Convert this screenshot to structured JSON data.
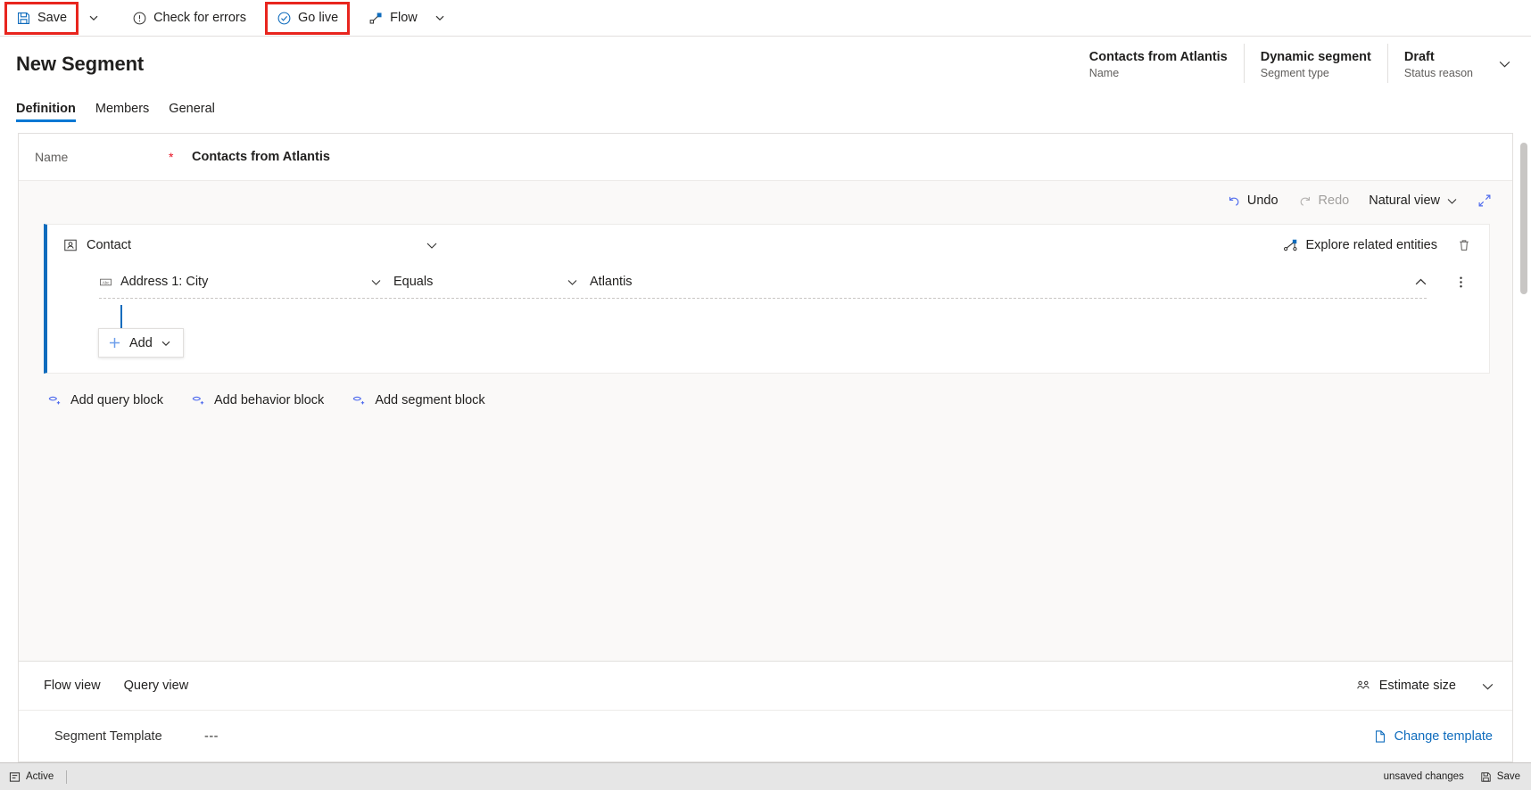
{
  "commandbar": {
    "save_label": "Save",
    "save_caret_icon": "chevron-down-icon",
    "check_errors_label": "Check for errors",
    "go_live_label": "Go live",
    "flow_label": "Flow",
    "flow_caret_icon": "chevron-down-icon",
    "highlight_color": "#e8251e"
  },
  "header": {
    "title": "New Segment",
    "meta": [
      {
        "value": "Contacts from Atlantis",
        "label": "Name"
      },
      {
        "value": "Dynamic segment",
        "label": "Segment type"
      },
      {
        "value": "Draft",
        "label": "Status reason"
      }
    ],
    "expand_icon": "chevron-down-icon"
  },
  "tabs": [
    {
      "label": "Definition",
      "active": true
    },
    {
      "label": "Members",
      "active": false
    },
    {
      "label": "General",
      "active": false
    }
  ],
  "name_field": {
    "label": "Name",
    "required_marker": "*",
    "value": "Contacts from Atlantis"
  },
  "editor_toolbar": {
    "undo_label": "Undo",
    "redo_label": "Redo",
    "view_label": "Natural view",
    "view_caret_icon": "chevron-down-icon",
    "expand_icon": "expand-diagonal-icon"
  },
  "query_block": {
    "entity_icon": "contact-entity-icon",
    "entity_label": "Contact",
    "collapse_icon": "chevron-down-icon",
    "explore_label": "Explore related entities",
    "explore_icon": "related-entities-icon",
    "delete_icon": "trash-icon",
    "condition": {
      "field_icon": "text-field-icon",
      "field": "Address 1: City",
      "operator": "Equals",
      "value": "Atlantis",
      "collapse_icon": "chevron-up-icon",
      "more_icon": "more-vertical-icon"
    },
    "add_button": {
      "label": "Add",
      "plus_icon": "plus-icon",
      "caret_icon": "chevron-down-icon"
    },
    "accent_color": "#0f6cbd"
  },
  "add_blocks": [
    {
      "label": "Add query block",
      "icon": "add-block-icon"
    },
    {
      "label": "Add behavior block",
      "icon": "add-block-icon"
    },
    {
      "label": "Add segment block",
      "icon": "add-block-icon"
    }
  ],
  "footer": {
    "view_tabs": [
      {
        "label": "Flow view"
      },
      {
        "label": "Query view"
      }
    ],
    "estimate_label": "Estimate size",
    "estimate_icon": "people-group-icon",
    "estimate_caret_icon": "chevron-down-icon",
    "template_label": "Segment Template",
    "template_value": "---",
    "change_template_label": "Change template",
    "change_template_icon": "document-page-icon"
  },
  "statusbar": {
    "state_icon": "form-icon",
    "state_label": "Active",
    "unsaved_label": "unsaved changes",
    "save_label": "Save",
    "save_icon": "save-icon"
  }
}
